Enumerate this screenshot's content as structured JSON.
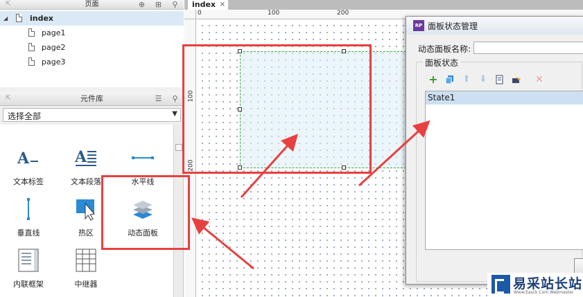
{
  "pages_panel": {
    "title": "页面",
    "root": "index",
    "children": [
      "page1",
      "page2",
      "page3"
    ]
  },
  "library_panel": {
    "title": "元件库",
    "filter_value": "选择全部",
    "widgets": [
      {
        "label": "文本标签",
        "icon": "text-label-icon"
      },
      {
        "label": "文本段落",
        "icon": "text-paragraph-icon"
      },
      {
        "label": "水平线",
        "icon": "horizontal-line-icon"
      },
      {
        "label": "垂直线",
        "icon": "vertical-line-icon"
      },
      {
        "label": "热区",
        "icon": "hotspot-icon"
      },
      {
        "label": "动态面板",
        "icon": "dynamic-panel-icon"
      },
      {
        "label": "内联框架",
        "icon": "inline-frame-icon"
      },
      {
        "label": "中继器",
        "icon": "repeater-icon"
      }
    ]
  },
  "canvas": {
    "tab": "index",
    "ruler_top": [
      "0",
      "100",
      "200"
    ],
    "ruler_left": [
      "100",
      "200"
    ]
  },
  "dialog": {
    "title": "面板状态管理",
    "name_label": "动态面板名称:",
    "name_value": "",
    "group_label": "面板状态",
    "states": [
      "State1"
    ]
  },
  "watermark": {
    "main": "易采站长站",
    "sub": "Www.Easck.Com Webmaster"
  },
  "colors": {
    "highlight": "#e84040",
    "selection": "#dbe9f6",
    "panel_border": "#3aa63a"
  }
}
